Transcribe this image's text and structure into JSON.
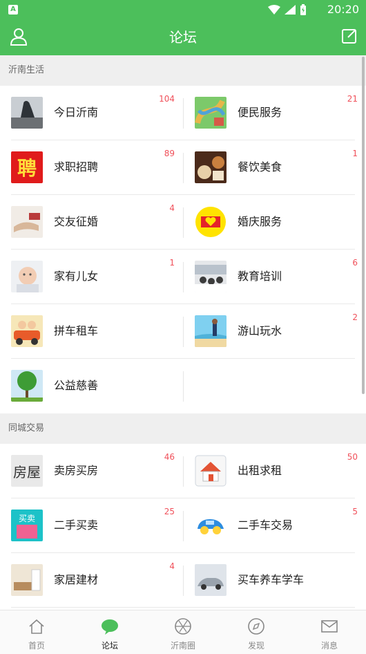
{
  "status": {
    "time": "20:20"
  },
  "header": {
    "title": "论坛"
  },
  "sections": [
    {
      "title": "沂南生活",
      "items": [
        {
          "label": "今日沂南",
          "count": "104"
        },
        {
          "label": "便民服务",
          "count": "21"
        },
        {
          "label": "求职招聘",
          "count": "89"
        },
        {
          "label": "餐饮美食",
          "count": "1"
        },
        {
          "label": "交友征婚",
          "count": "4"
        },
        {
          "label": "婚庆服务",
          "count": ""
        },
        {
          "label": "家有儿女",
          "count": "1"
        },
        {
          "label": "教育培训",
          "count": "6"
        },
        {
          "label": "拼车租车",
          "count": ""
        },
        {
          "label": "游山玩水",
          "count": "2"
        },
        {
          "label": "公益慈善",
          "count": ""
        }
      ]
    },
    {
      "title": "同城交易",
      "items": [
        {
          "label": "卖房买房",
          "count": "46"
        },
        {
          "label": "出租求租",
          "count": "50"
        },
        {
          "label": "二手买卖",
          "count": "25"
        },
        {
          "label": "二手车交易",
          "count": "5"
        },
        {
          "label": "家居建材",
          "count": "4"
        },
        {
          "label": "买车养车学车",
          "count": ""
        }
      ]
    }
  ],
  "thumbs": {
    "thumb_text_job": "聘",
    "thumb_text_house": "房屋",
    "thumb_text_trade": "买卖"
  },
  "tabs": [
    {
      "label": "首页",
      "icon": "home-icon"
    },
    {
      "label": "论坛",
      "icon": "chat-bubble-icon"
    },
    {
      "label": "沂南圈",
      "icon": "aperture-icon"
    },
    {
      "label": "发现",
      "icon": "compass-icon"
    },
    {
      "label": "消息",
      "icon": "mail-icon"
    }
  ],
  "colors": {
    "accent": "#4cbf5b",
    "badge": "#f0505a"
  }
}
